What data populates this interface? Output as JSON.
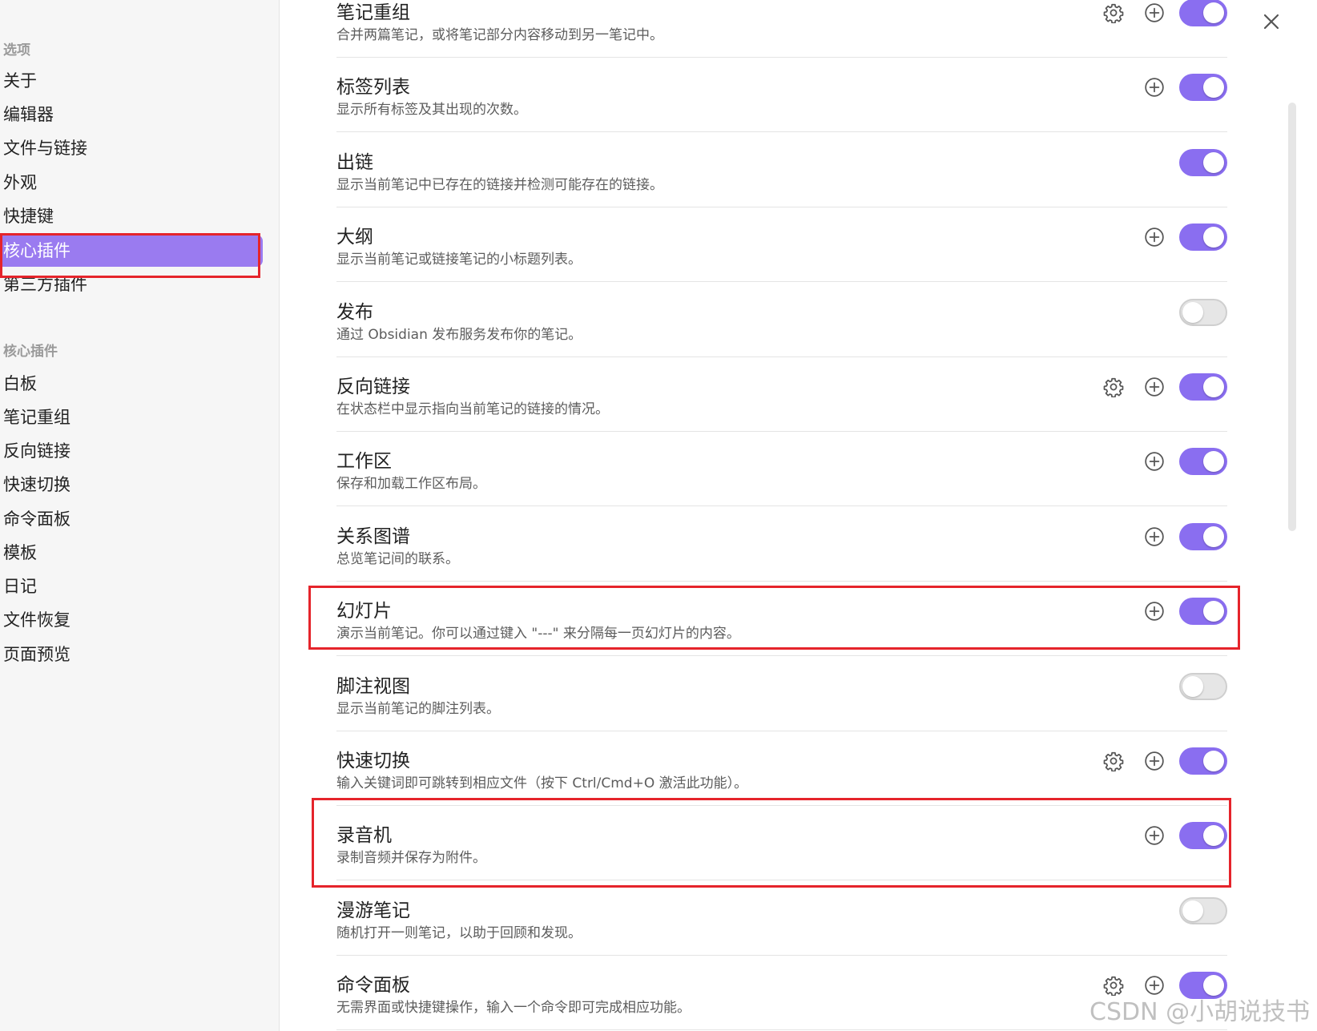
{
  "sidebar": {
    "options_heading": "选项",
    "options_items": [
      "关于",
      "编辑器",
      "文件与链接",
      "外观",
      "快捷键",
      "核心插件",
      "第三方插件"
    ],
    "core_heading": "核心插件",
    "core_items": [
      "白板",
      "笔记重组",
      "反向链接",
      "快速切换",
      "命令面板",
      "模板",
      "日记",
      "文件恢复",
      "页面预览"
    ]
  },
  "plugins": [
    {
      "title": "笔记重组",
      "desc": "合并两篇笔记，或将笔记部分内容移动到另一笔记中。",
      "gear": true,
      "plus": true,
      "enabled": true
    },
    {
      "title": "标签列表",
      "desc": "显示所有标签及其出现的次数。",
      "gear": false,
      "plus": true,
      "enabled": true
    },
    {
      "title": "出链",
      "desc": "显示当前笔记中已存在的链接并检测可能存在的链接。",
      "gear": false,
      "plus": false,
      "enabled": true
    },
    {
      "title": "大纲",
      "desc": "显示当前笔记或链接笔记的小标题列表。",
      "gear": false,
      "plus": true,
      "enabled": true
    },
    {
      "title": "发布",
      "desc": "通过 Obsidian 发布服务发布你的笔记。",
      "gear": false,
      "plus": false,
      "enabled": false
    },
    {
      "title": "反向链接",
      "desc": "在状态栏中显示指向当前笔记的链接的情况。",
      "gear": true,
      "plus": true,
      "enabled": true
    },
    {
      "title": "工作区",
      "desc": "保存和加载工作区布局。",
      "gear": false,
      "plus": true,
      "enabled": true
    },
    {
      "title": "关系图谱",
      "desc": "总览笔记间的联系。",
      "gear": false,
      "plus": true,
      "enabled": true
    },
    {
      "title": "幻灯片",
      "desc": "演示当前笔记。你可以通过键入 \"---\" 来分隔每一页幻灯片的内容。",
      "gear": false,
      "plus": true,
      "enabled": true
    },
    {
      "title": "脚注视图",
      "desc": "显示当前笔记的脚注列表。",
      "gear": false,
      "plus": false,
      "enabled": false
    },
    {
      "title": "快速切换",
      "desc": "输入关键词即可跳转到相应文件（按下 Ctrl/Cmd+O 激活此功能）。",
      "gear": true,
      "plus": true,
      "enabled": true
    },
    {
      "title": "录音机",
      "desc": "录制音频并保存为附件。",
      "gear": false,
      "plus": true,
      "enabled": true
    },
    {
      "title": "漫游笔记",
      "desc": "随机打开一则笔记，以助于回顾和发现。",
      "gear": false,
      "plus": false,
      "enabled": false
    },
    {
      "title": "命令面板",
      "desc": "无需界面或快捷键操作，输入一个命令即可完成相应功能。",
      "gear": true,
      "plus": true,
      "enabled": true
    }
  ],
  "watermark": "CSDN @小胡说技书",
  "colors": {
    "accent": "#8a6ef0",
    "sidebar_active": "#9a7bf0",
    "highlight_box": "#e5242b"
  }
}
